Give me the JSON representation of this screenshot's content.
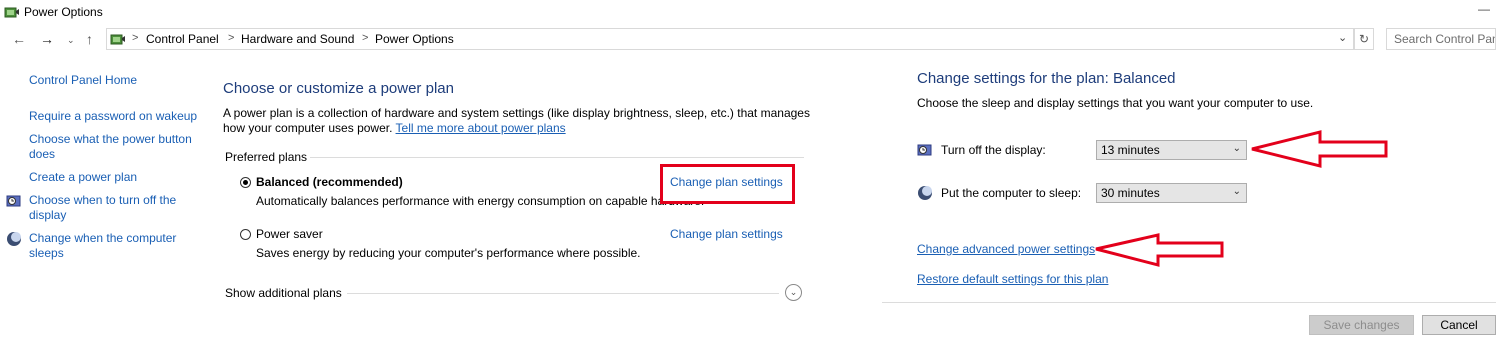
{
  "window": {
    "title": "Power Options",
    "close_label": "—"
  },
  "nav": {
    "back_icon": "arrow-left-icon",
    "forward_icon": "arrow-right-icon",
    "recent_icon": "chevron-down-icon",
    "up_icon": "arrow-up-icon"
  },
  "address": {
    "breadcrumbs": [
      "Control Panel",
      "Hardware and Sound",
      "Power Options"
    ],
    "separator": ">"
  },
  "search": {
    "placeholder": "Search Control Pan"
  },
  "sidebar": {
    "home": "Control Panel Home",
    "items": [
      {
        "label_line1": "Require a password on wakeup"
      },
      {
        "label_line1": "Choose what the power button",
        "label_line2": "does"
      },
      {
        "label_line1": "Create a power plan"
      },
      {
        "label_line1": "Choose when to turn off the",
        "label_line2": "display"
      },
      {
        "label_line1": "Change when the computer",
        "label_line2": "sleeps"
      }
    ]
  },
  "main": {
    "heading": "Choose or customize a power plan",
    "desc_line1": "A power plan is a collection of hardware and system settings (like display brightness, sleep, etc.) that manages",
    "desc_line2": "how your computer uses power.",
    "tell_more": "Tell me more about power plans",
    "preferred_label": "Preferred plans",
    "plans": [
      {
        "name": "Balanced (recommended)",
        "description": "Automatically balances performance with energy consumption on capable hardware.",
        "selected": true,
        "change_link": "Change plan settings"
      },
      {
        "name": "Power saver",
        "description": "Saves energy by reducing your computer's performance where possible.",
        "selected": false,
        "change_link": "Change plan settings"
      }
    ],
    "show_additional": "Show additional plans"
  },
  "plan_settings": {
    "heading": "Change settings for the plan: Balanced",
    "subtitle": "Choose the sleep and display settings that you want your computer to use.",
    "display_label": "Turn off the display:",
    "display_value": "13 minutes",
    "sleep_label": "Put the computer to sleep:",
    "sleep_value": "30 minutes",
    "advanced_link": "Change advanced power settings",
    "restore_link": "Restore default settings for this plan",
    "save_button": "Save changes",
    "cancel_button": "Cancel"
  },
  "colors": {
    "link": "#1a5fb4",
    "heading": "#1e3d7b",
    "annotation": "#e3001b"
  }
}
